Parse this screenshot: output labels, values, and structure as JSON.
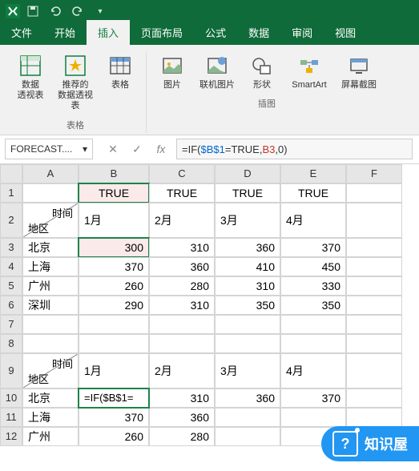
{
  "titlebar": {
    "app_icon": "excel-icon"
  },
  "tabs": {
    "file": "文件",
    "home": "开始",
    "insert": "插入",
    "layout": "页面布局",
    "formulas": "公式",
    "data": "数据",
    "review": "审阅",
    "view": "视图"
  },
  "ribbon": {
    "groups": {
      "tables": {
        "label": "表格",
        "items": {
          "pivot": "数据\n透视表",
          "rec_pivot": "推荐的\n数据透视表",
          "table": "表格"
        }
      },
      "illus": {
        "label": "插图",
        "items": {
          "pictures": "图片",
          "online_pics": "联机图片",
          "shapes": "形状",
          "smartart": "SmartArt",
          "screenshot": "屏幕截图"
        }
      }
    }
  },
  "formula_bar": {
    "name": "FORECAST....",
    "formula_display": "=IF($B$1=TRUE,B3,0)",
    "formula_parts": {
      "eq": "=",
      "fn": "IF(",
      "abs": "$B$1",
      "mid": "=TRUE,",
      "ref": "B3",
      "tail": ",0)"
    }
  },
  "columns": [
    "A",
    "B",
    "C",
    "D",
    "E",
    "F"
  ],
  "rows": [
    "1",
    "2",
    "3",
    "4",
    "5",
    "6",
    "7",
    "8",
    "9",
    "10",
    "11",
    "12"
  ],
  "grid": {
    "r1": {
      "B": "TRUE",
      "C": "TRUE",
      "D": "TRUE",
      "E": "TRUE"
    },
    "r2": {
      "A_tl": "时间",
      "A_br": "地区",
      "B": "1月",
      "C": "2月",
      "D": "3月",
      "E": "4月"
    },
    "r3": {
      "A": "北京",
      "B": "300",
      "C": "310",
      "D": "360",
      "E": "370"
    },
    "r4": {
      "A": "上海",
      "B": "370",
      "C": "360",
      "D": "410",
      "E": "450"
    },
    "r5": {
      "A": "广州",
      "B": "260",
      "C": "280",
      "D": "310",
      "E": "330"
    },
    "r6": {
      "A": "深圳",
      "B": "290",
      "C": "310",
      "D": "350",
      "E": "350"
    },
    "r9": {
      "A_tl": "时间",
      "A_br": "地区",
      "B": "1月",
      "C": "2月",
      "D": "3月",
      "E": "4月"
    },
    "r10": {
      "A": "北京",
      "B": "=IF($B$1=",
      "C": "310",
      "D": "360",
      "E": "370"
    },
    "r11": {
      "A": "上海",
      "B": "370",
      "C": "360"
    },
    "r12": {
      "A": "广州",
      "B": "260",
      "C": "280"
    }
  },
  "watermark": {
    "text": "知识屋",
    "q": "?"
  },
  "icons": {
    "dropdown": "▾",
    "cancel": "✕",
    "enter": "✓",
    "fx": "fx"
  }
}
